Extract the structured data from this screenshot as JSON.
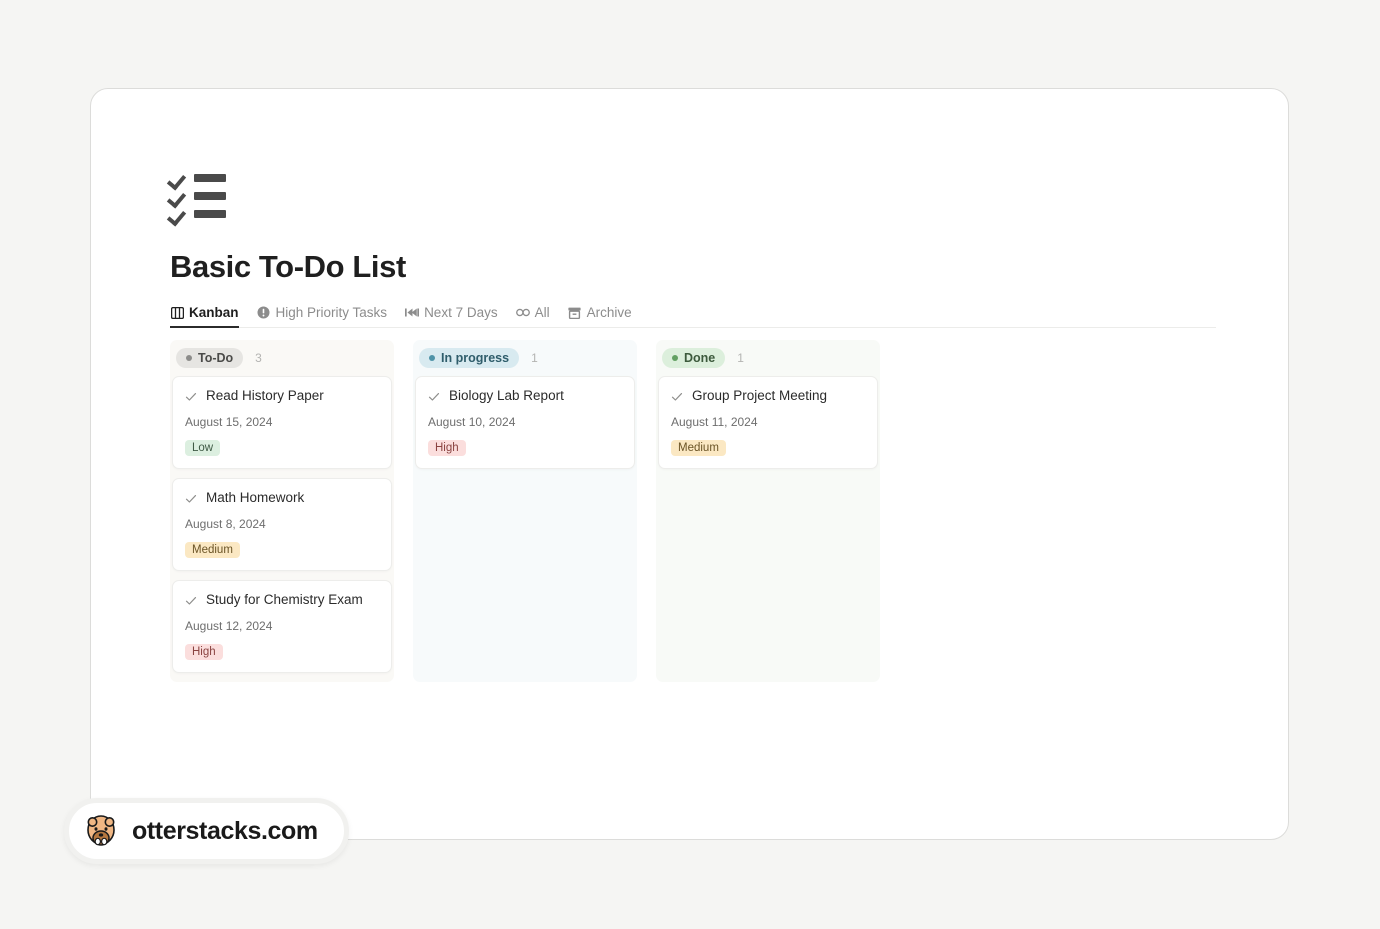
{
  "app": {
    "logo_icon": "checklist-icon",
    "title": "Basic To-Do List"
  },
  "tabs": [
    {
      "label": "Kanban",
      "icon": "board-columns-icon",
      "glyph": "▥",
      "active": true
    },
    {
      "label": "High Priority Tasks",
      "icon": "exclamation-circle-icon",
      "glyph": "!",
      "active": false
    },
    {
      "label": "Next 7 Days",
      "icon": "skip-forward-icon",
      "glyph": "▶▶",
      "active": false
    },
    {
      "label": "All",
      "icon": "infinity-icon",
      "glyph": "∞",
      "active": false
    },
    {
      "label": "Archive",
      "icon": "archive-box-icon",
      "glyph": "▤",
      "active": false
    }
  ],
  "board": {
    "columns": [
      {
        "name": "To-Do",
        "count": "3",
        "pill_bg": "#e6e5e2",
        "pill_text": "#4a4a48",
        "dot_color": "#8c8c8a",
        "cards": [
          {
            "title": "Read History Paper",
            "date": "August 15, 2024",
            "priority": "Low",
            "priority_class": "tag-low"
          },
          {
            "title": "Math Homework",
            "date": "August 8, 2024",
            "priority": "Medium",
            "priority_class": "tag-medium"
          },
          {
            "title": "Study for Chemistry Exam",
            "date": "August 12, 2024",
            "priority": "High",
            "priority_class": "tag-high"
          }
        ]
      },
      {
        "name": "In progress",
        "count": "1",
        "pill_bg": "#d8eaf0",
        "pill_text": "#2f5d6b",
        "dot_color": "#4e93a8",
        "cards": [
          {
            "title": "Biology Lab Report",
            "date": "August 10, 2024",
            "priority": "High",
            "priority_class": "tag-high"
          }
        ]
      },
      {
        "name": "Done",
        "count": "1",
        "pill_bg": "#dcefdc",
        "pill_text": "#3c5a3c",
        "dot_color": "#62a062",
        "cards": [
          {
            "title": "Group Project Meeting",
            "date": "August 11, 2024",
            "priority": "Medium",
            "priority_class": "tag-medium"
          }
        ]
      }
    ]
  },
  "watermark": {
    "text": "otterstacks.com",
    "icon": "otter-avatar-icon"
  }
}
